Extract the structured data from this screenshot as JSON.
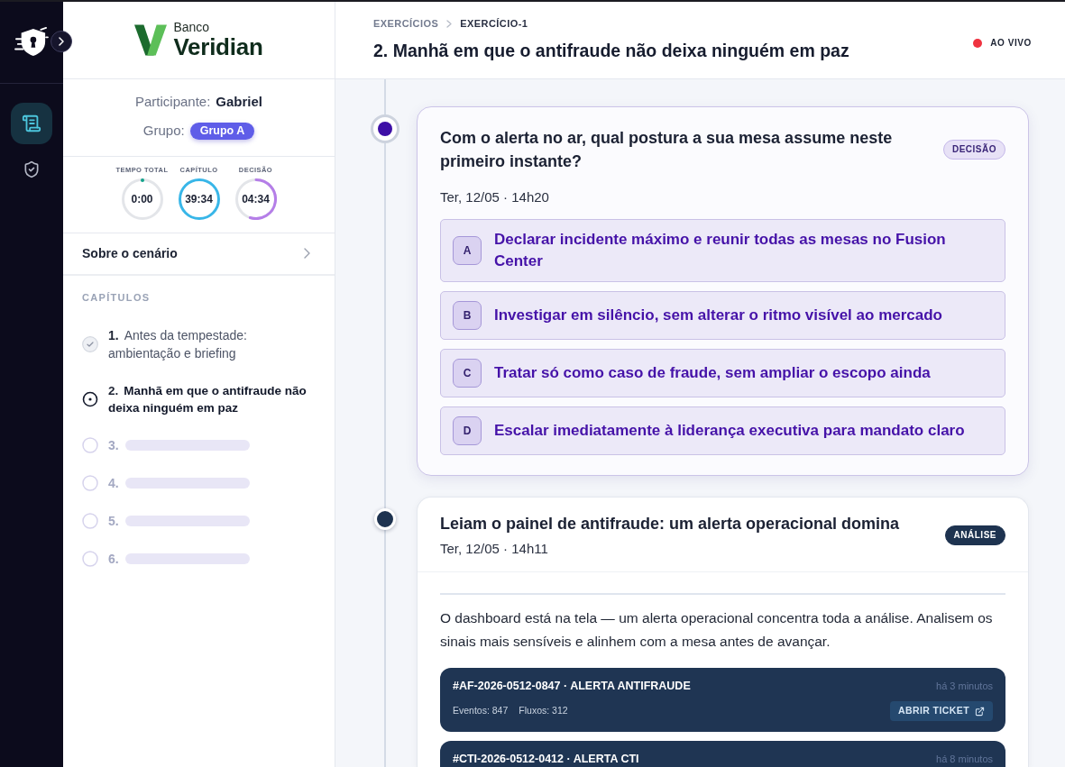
{
  "rail": {
    "nav": [
      {
        "kind": "exercise",
        "selected": true
      },
      {
        "kind": "security",
        "selected": false
      }
    ]
  },
  "sidebar": {
    "logo": {
      "line1": "Banco",
      "line2": "Veridian"
    },
    "participant": {
      "label": "Participante:",
      "value": "Gabriel"
    },
    "group": {
      "label": "Grupo:",
      "value": "Grupo A"
    },
    "timers": [
      {
        "label": "TEMPO TOTAL",
        "value": "0:00",
        "color": "#14a38b"
      },
      {
        "label": "CAPÍTULO",
        "value": "39:34",
        "level": 1,
        "color": "#38b6e8"
      },
      {
        "label": "DECISÃO",
        "value": "04:34",
        "level": 0.55,
        "color": "#b57ee8"
      }
    ],
    "scenario_link": "Sobre o cenário",
    "chapters_heading": "CAPÍTULOS",
    "chapters": [
      {
        "number": "1.",
        "title": "Antes da tempestade: ambientação e briefing",
        "completed": true,
        "selected": false,
        "locked": false
      },
      {
        "number": "2.",
        "title": "Manhã em que o antifraude não deixa ninguém em paz",
        "completed": false,
        "selected": true,
        "locked": false
      },
      {
        "number": "3.",
        "completed": false,
        "selected": false,
        "locked": true
      },
      {
        "number": "4.",
        "completed": false,
        "selected": false,
        "locked": true
      },
      {
        "number": "5.",
        "completed": false,
        "selected": false,
        "locked": true
      },
      {
        "number": "6.",
        "completed": false,
        "selected": false,
        "locked": true
      }
    ]
  },
  "header": {
    "breadcrumb": [
      {
        "label": "EXERCÍCIOS",
        "selected": false
      },
      {
        "label": "EXERCÍCIO-1",
        "selected": true
      }
    ],
    "title": "2. Manhã em que o antifraude não deixa ninguém em paz",
    "live_label": "AO VIVO"
  },
  "timeline": [
    {
      "kind": "decision",
      "current": true,
      "title": "Com o alerta no ar, qual postura a sua mesa assume neste primeiro instante?",
      "badge": "DECISÃO",
      "time": "Ter, 12/05 · 14h20",
      "options": [
        {
          "letter": "A",
          "text": "Declarar incidente máximo e reunir todas as mesas no Fusion Center",
          "selected": false
        },
        {
          "letter": "B",
          "text": "Investigar em silêncio, sem alterar o ritmo visível ao mercado",
          "selected": false
        },
        {
          "letter": "C",
          "text": "Tratar só como caso de fraude, sem ampliar o escopo ainda",
          "selected": false
        },
        {
          "letter": "D",
          "text": "Escalar imediatamente à liderança executiva para mandato claro",
          "selected": false
        }
      ]
    },
    {
      "kind": "analysis",
      "current": false,
      "title": "Leiam o painel de antifraude: um alerta operacional domina",
      "badge": "ANÁLISE",
      "time": "Ter, 12/05 · 14h11",
      "body": "O dashboard está na tela — um alerta operacional concentra toda a análise. Analisem os sinais mais sensíveis e alinhem com a mesa antes de avançar.",
      "alerts": [
        {
          "title": "#AF-2026-0512-0847 · ALERTA ANTIFRAUDE",
          "age": "há 3 minutos",
          "stats": [
            "Eventos: 847",
            "Fluxos: 312"
          ],
          "action": "ABRIR TICKET"
        },
        {
          "title": "#CTI-2026-0512-0412 · ALERTA CTI",
          "age": "há 8 minutos"
        }
      ]
    }
  ]
}
